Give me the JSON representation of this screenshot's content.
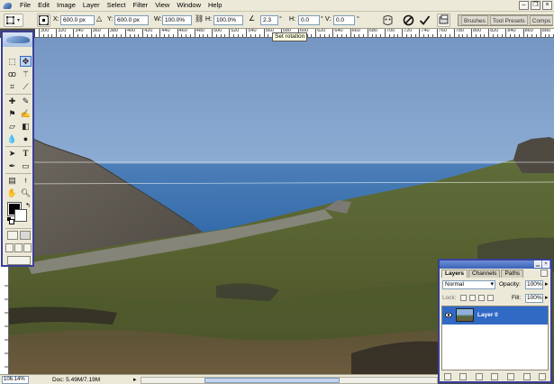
{
  "menubar": {
    "app_icon": "photoshop-feather-icon",
    "items": [
      "File",
      "Edit",
      "Image",
      "Layer",
      "Select",
      "Filter",
      "View",
      "Window",
      "Help"
    ]
  },
  "options": {
    "x_label": "X:",
    "x_value": "600.0 px",
    "y_label": "Y:",
    "y_value": "600.0 px",
    "w_label": "W:",
    "w_value": "100.0%",
    "h_label": "H:",
    "h_value": "100.0%",
    "angle_value": "2.3",
    "hskew_label": "H:",
    "hskew_value": "0.0",
    "vskew_label": "V:",
    "vskew_value": "0.0",
    "deg": "°",
    "palette_well": [
      "Brushes",
      "Tool Presets",
      "Comps"
    ]
  },
  "ruler": {
    "labels": [
      "300",
      "320",
      "340",
      "360",
      "380",
      "400",
      "420",
      "440",
      "460",
      "480",
      "500",
      "520",
      "540",
      "560",
      "580",
      "600",
      "620",
      "640",
      "660",
      "680",
      "700",
      "720",
      "740",
      "760",
      "780",
      "800",
      "820",
      "840",
      "860",
      "880"
    ]
  },
  "tooltip": "Set rotation",
  "layers": {
    "tabs": [
      "Layers",
      "Channels",
      "Paths"
    ],
    "blend_mode": "Normal",
    "opacity_label": "Opacity:",
    "opacity": "100%",
    "lock_label": "Lock:",
    "fill_label": "Fill:",
    "fill": "100%",
    "layer_name": "Layer 0"
  },
  "status": {
    "zoom": "106.14%",
    "doc": "Doc: 5.49M/7.19M"
  },
  "colors": {
    "chrome": "#ece9d8",
    "panel_border": "#3a3f99",
    "selection": "#316ac5"
  }
}
